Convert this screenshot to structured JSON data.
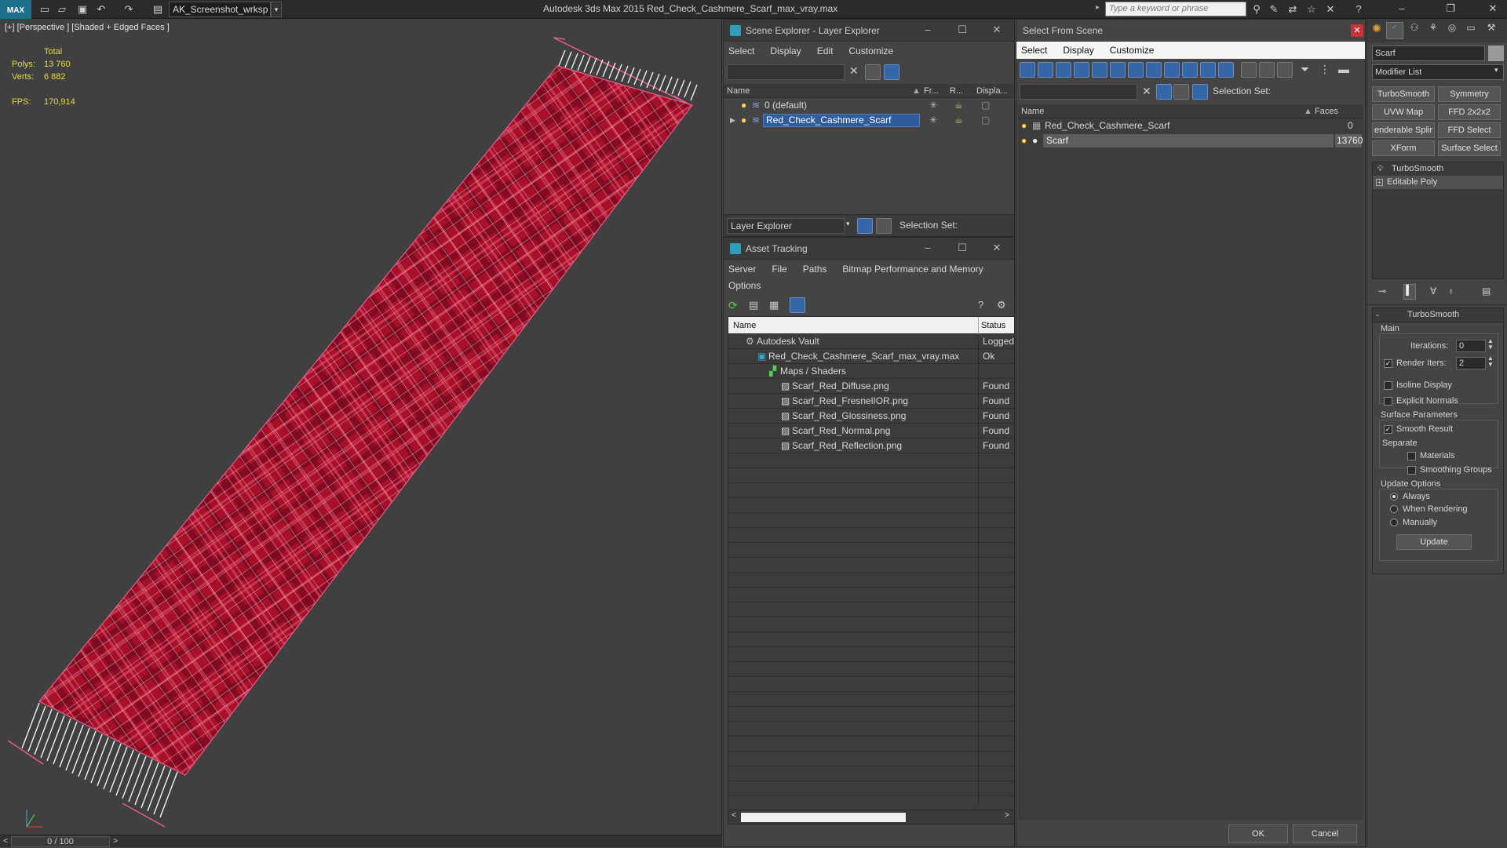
{
  "app": {
    "logo": "MAX",
    "workspace": "AK_Screenshot_wrksp",
    "title": "Autodesk 3ds Max  2015    Red_Check_Cashmere_Scarf_max_vray.max",
    "search_placeholder": "Type a keyword or phrase"
  },
  "viewport": {
    "label": "[+] [Perspective ] [Shaded + Edged Faces ]",
    "stats": {
      "total_label": "Total",
      "polys_label": "Polys:",
      "polys_value": "13 760",
      "verts_label": "Verts:",
      "verts_value": "6 882",
      "fps_label": "FPS:",
      "fps_value": "170,914"
    },
    "colors": {
      "scarf_red": "#b3122a",
      "wire_white": "#f2f2f2",
      "bbox_pink": "#e65c8c"
    }
  },
  "timeline": {
    "value": "0 / 100"
  },
  "scene_explorer": {
    "title": "Scene Explorer - Layer Explorer",
    "menu": [
      "Select",
      "Display",
      "Edit",
      "Customize"
    ],
    "columns": [
      "Name",
      "Fr...",
      "R...",
      "Displa..."
    ],
    "rows": [
      {
        "name": "0 (default)"
      },
      {
        "name": "Red_Check_Cashmere_Scarf"
      }
    ],
    "footer_dropdown": "Layer Explorer",
    "selection_set_label": "Selection Set:"
  },
  "asset_tracking": {
    "title": "Asset Tracking",
    "menu": [
      "Server",
      "File",
      "Paths",
      "Bitmap Performance and Memory"
    ],
    "menu2": [
      "Options"
    ],
    "columns": [
      "Name",
      "Status"
    ],
    "rows": [
      {
        "name": "Autodesk Vault",
        "status": "Logged",
        "indent": 0
      },
      {
        "name": "Red_Check_Cashmere_Scarf_max_vray.max",
        "status": "Ok",
        "indent": 1
      },
      {
        "name": "Maps / Shaders",
        "status": "",
        "indent": 2
      },
      {
        "name": "Scarf_Red_Diffuse.png",
        "status": "Found",
        "indent": 3
      },
      {
        "name": "Scarf_Red_FresnelIOR.png",
        "status": "Found",
        "indent": 3
      },
      {
        "name": "Scarf_Red_Glossiness.png",
        "status": "Found",
        "indent": 3
      },
      {
        "name": "Scarf_Red_Normal.png",
        "status": "Found",
        "indent": 3
      },
      {
        "name": "Scarf_Red_Reflection.png",
        "status": "Found",
        "indent": 3
      }
    ]
  },
  "select_from_scene": {
    "title": "Select From Scene",
    "menu": [
      "Select",
      "Display",
      "Customize"
    ],
    "selection_set_label": "Selection Set:",
    "columns": [
      "Name",
      "Faces"
    ],
    "rows": [
      {
        "name": "Red_Check_Cashmere_Scarf",
        "faces": "0"
      },
      {
        "name": "Scarf",
        "faces": "13760"
      }
    ],
    "ok_label": "OK",
    "cancel_label": "Cancel"
  },
  "command_panel": {
    "object_name": "Scarf",
    "modifier_list": "Modifier List",
    "buttons": [
      "TurboSmooth",
      "Symmetry",
      "UVW Map",
      "FFD 2x2x2",
      "enderable Splir",
      "FFD Select",
      "XForm",
      "Surface Select"
    ],
    "stack": [
      "TurboSmooth",
      "Editable Poly"
    ],
    "rollout_title": "TurboSmooth",
    "main_label": "Main",
    "iterations_label": "Iterations:",
    "iterations_value": "0",
    "render_iters_label": "Render Iters:",
    "render_iters_value": "2",
    "isoline_label": "Isoline Display",
    "explicit_normals_label": "Explicit Normals",
    "surface_params_label": "Surface Parameters",
    "smooth_result_label": "Smooth Result",
    "separate_label": "Separate",
    "materials_label": "Materials",
    "smoothing_groups_label": "Smoothing Groups",
    "update_options_label": "Update Options",
    "always_label": "Always",
    "when_rendering_label": "When Rendering",
    "manually_label": "Manually",
    "update_button": "Update"
  }
}
